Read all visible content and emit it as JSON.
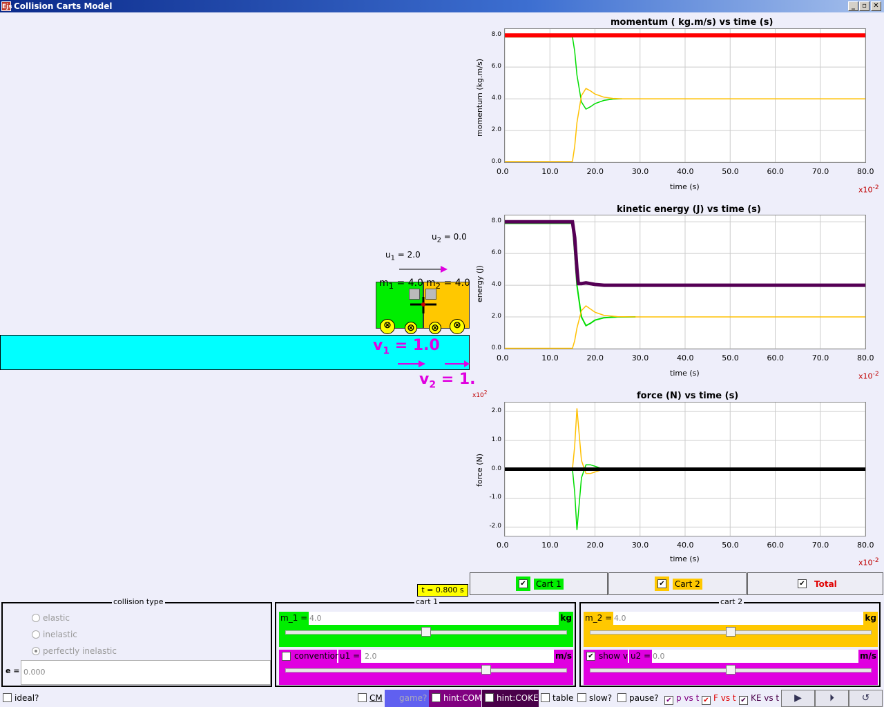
{
  "window": {
    "title": "Collision Carts Model",
    "app_icon": "Ejs",
    "min": "_",
    "max": "▫",
    "close": "✕"
  },
  "sim": {
    "u1_label": "u",
    "u1_sub": "1",
    "u1_value": " = 2.0",
    "u2_label": "u",
    "u2_sub": "2",
    "u2_value": " = 0.0",
    "m1_label": "m",
    "m1_sub": "1",
    "m1_value": " = 4.0",
    "m2_label": "m",
    "m2_sub": "2",
    "m2_value": " = 4.0",
    "v1_label": "v",
    "v1_sub": "1",
    "v1_value": " = 1.0",
    "v2_label": "v",
    "v2_sub": "2",
    "v2_value": " = 1.",
    "cart1_color": "#00ee00",
    "cart2_color": "#ffc800",
    "track_color": "#00ffff"
  },
  "graphs": {
    "momentum": {
      "title": "momentum ( kg.m/s) vs time (s)",
      "ylabel": "momentum (kg.m/s)",
      "xlabel": "time (s)",
      "mult": "x10",
      "mult_exp": "-2",
      "yticks": [
        "8.0",
        "6.0",
        "4.0",
        "2.0",
        "0.0"
      ]
    },
    "energy": {
      "title": "kinetic energy (J) vs time (s)",
      "ylabel": "energy (J)",
      "xlabel": "time (s)",
      "mult": "x10",
      "mult_exp": "-2",
      "yticks": [
        "8.0",
        "6.0",
        "4.0",
        "2.0",
        "0.0"
      ]
    },
    "force": {
      "title": "force (N) vs time (s)",
      "ylabel": "force (N)",
      "xlabel": "time (s)",
      "mult": "x10",
      "mult_exp": "-2",
      "ymult": "x10",
      "ymult_exp": "2",
      "yticks": [
        "2.0",
        "1.0",
        "0.0",
        "-1.0",
        "-2.0"
      ]
    },
    "xticks": [
      "0.0",
      "10.0",
      "20.0",
      "30.0",
      "40.0",
      "50.0",
      "60.0",
      "70.0",
      "80.0"
    ]
  },
  "chart_data": [
    {
      "type": "line",
      "title": "momentum ( kg.m/s) vs time (s)",
      "xlabel": "time (s)",
      "ylabel": "momentum (kg.m/s)",
      "xlim": [
        0,
        80
      ],
      "ylim": [
        0,
        8.4
      ],
      "series": [
        {
          "name": "Cart 1",
          "color": "#00dd00",
          "x": [
            0,
            15,
            15.5,
            16,
            17,
            18,
            19,
            20,
            22,
            24,
            26
          ],
          "y": [
            7.9,
            7.9,
            7,
            5.5,
            3.8,
            3.35,
            3.5,
            3.7,
            3.9,
            3.98,
            4.0
          ]
        },
        {
          "name": "Cart 2",
          "color": "#ffc000",
          "x": [
            0,
            15,
            15.5,
            16,
            17,
            18,
            19,
            20,
            22,
            24,
            26,
            80
          ],
          "y": [
            0.05,
            0.05,
            1,
            2.5,
            4.2,
            4.65,
            4.5,
            4.3,
            4.1,
            4.02,
            4.0,
            4.0
          ]
        },
        {
          "name": "Total",
          "color": "#ff0000",
          "x": [
            0,
            80
          ],
          "y": [
            8.0,
            8.0
          ]
        }
      ]
    },
    {
      "type": "line",
      "title": "kinetic energy (J) vs time (s)",
      "xlabel": "time (s)",
      "ylabel": "energy (J)",
      "xlim": [
        0,
        80
      ],
      "ylim": [
        0,
        8.4
      ],
      "series": [
        {
          "name": "Cart 1",
          "color": "#00dd00",
          "x": [
            0,
            15,
            15.5,
            16,
            17,
            18,
            19,
            20,
            22,
            25,
            29
          ],
          "y": [
            7.9,
            7.9,
            6,
            4,
            2,
            1.45,
            1.6,
            1.8,
            1.95,
            2.0,
            2.0
          ]
        },
        {
          "name": "Cart 2",
          "color": "#ffc000",
          "x": [
            0,
            15,
            15.5,
            16,
            17,
            18,
            19,
            20,
            22,
            25,
            29,
            80
          ],
          "y": [
            0.02,
            0.02,
            0.5,
            1.3,
            2.4,
            2.7,
            2.5,
            2.3,
            2.1,
            2.02,
            2.0,
            2.0
          ]
        },
        {
          "name": "Total",
          "color": "#550055",
          "x": [
            0,
            15,
            15.5,
            16,
            16.3,
            17,
            18,
            20,
            22,
            80
          ],
          "y": [
            8.0,
            8.0,
            7.0,
            5.0,
            4.1,
            4.1,
            4.15,
            4.05,
            4.0,
            4.0
          ]
        }
      ]
    },
    {
      "type": "line",
      "title": "force (N) vs time (s)",
      "xlabel": "time (s)",
      "ylabel": "force (N)",
      "xlim": [
        0,
        80
      ],
      "ylim": [
        -2.3,
        2.3
      ],
      "series": [
        {
          "name": "Cart 1",
          "color": "#00dd00",
          "x": [
            0,
            15,
            15.5,
            16,
            16.5,
            17,
            18,
            19,
            20,
            21,
            22,
            24,
            26,
            80
          ],
          "y": [
            0,
            0,
            -0.8,
            -2.1,
            -1.2,
            -0.3,
            0.15,
            0.15,
            0.1,
            0.05,
            0,
            0,
            0,
            0
          ]
        },
        {
          "name": "Cart 2",
          "color": "#ffc000",
          "x": [
            0,
            15,
            15.5,
            16,
            16.5,
            17,
            18,
            19,
            20,
            21,
            22,
            24,
            26,
            80
          ],
          "y": [
            0,
            0,
            0.8,
            2.1,
            1.2,
            0.3,
            -0.15,
            -0.15,
            -0.1,
            -0.05,
            0,
            0,
            0,
            0
          ]
        },
        {
          "name": "Total",
          "color": "#000000",
          "x": [
            0,
            80
          ],
          "y": [
            0,
            0
          ]
        }
      ]
    }
  ],
  "legend": {
    "cart1": "Cart 1",
    "cart2": "Cart 2",
    "total": "Total",
    "check": "✔"
  },
  "time_display": "t = 0.800 s",
  "collision_panel": {
    "title": "collision type",
    "elastic": "elastic",
    "inelastic": "inelastic",
    "perfect": "perfectly inelastic",
    "e_label": "e =",
    "e_value": "0.000"
  },
  "cart1_panel": {
    "title": "cart 1",
    "m_label": "m_1 =",
    "m_value": "4.0",
    "m_unit": "kg",
    "m_fraction": 0.5,
    "conv_label": "convention",
    "u_label": "u1 =",
    "u_value": "2.0",
    "u_unit": "m/s",
    "u_fraction": 0.72
  },
  "cart2_panel": {
    "title": "cart 2",
    "m_label": "m_2 =",
    "m_value": "4.0",
    "m_unit": "kg",
    "m_fraction": 0.5,
    "show_label": "show v",
    "u_label": "u2 =",
    "u_value": "0.0",
    "u_unit": "m/s",
    "u_fraction": 0.5
  },
  "bottombar": {
    "ideal": "ideal?",
    "cm": "CM",
    "game": "game?",
    "hint_com": "hint:COM",
    "hint_coke": "hint:COKE",
    "table": "table",
    "slow": "slow?",
    "pause": "pause?",
    "p_vs_t": "p vs t",
    "f_vs_t": "F vs t",
    "ke_vs_t": "KE vs t",
    "play": "▶",
    "step": "⏵",
    "reset": "↺",
    "check": "✔"
  }
}
